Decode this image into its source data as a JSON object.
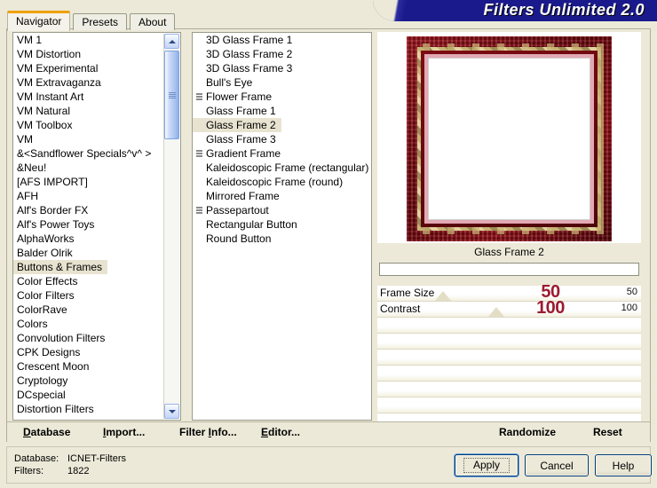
{
  "window": {
    "title": "Filters Unlimited 2.0"
  },
  "tabs": [
    {
      "label": "Navigator",
      "active": true
    },
    {
      "label": "Presets",
      "active": false
    },
    {
      "label": "About",
      "active": false
    }
  ],
  "categories": {
    "selected": "Buttons & Frames",
    "items": [
      "VM 1",
      "VM Distortion",
      "VM Experimental",
      "VM Extravaganza",
      "VM Instant Art",
      "VM Natural",
      "VM Toolbox",
      "VM",
      "&<Sandflower Specials^v^ >",
      "&Neu!",
      "[AFS IMPORT]",
      "AFH",
      "Alf's Border FX",
      "Alf's Power Toys",
      "AlphaWorks",
      "Balder Olrik",
      "Buttons & Frames",
      "Color Effects",
      "Color Filters",
      "ColorRave",
      "Colors",
      "Convolution Filters",
      "CPK Designs",
      "Crescent Moon",
      "Cryptology",
      "DCspecial",
      "Distortion Filters"
    ]
  },
  "filters": {
    "selected": "Glass Frame 2",
    "items": [
      {
        "label": "3D Glass Frame 1",
        "icon": false
      },
      {
        "label": "3D Glass Frame 2",
        "icon": false
      },
      {
        "label": "3D Glass Frame 3",
        "icon": false
      },
      {
        "label": "Bull's Eye",
        "icon": false
      },
      {
        "label": "Flower Frame",
        "icon": true
      },
      {
        "label": "Glass Frame 1",
        "icon": false
      },
      {
        "label": "Glass Frame 2",
        "icon": false
      },
      {
        "label": "Glass Frame 3",
        "icon": false
      },
      {
        "label": "Gradient Frame",
        "icon": true
      },
      {
        "label": "Kaleidoscopic Frame (rectangular)",
        "icon": false
      },
      {
        "label": "Kaleidoscopic Frame (round)",
        "icon": false
      },
      {
        "label": "Mirrored Frame",
        "icon": false
      },
      {
        "label": "Passepartout",
        "icon": true
      },
      {
        "label": "Rectangular Button",
        "icon": false
      },
      {
        "label": "Round Button",
        "icon": false
      }
    ]
  },
  "controls": {
    "title": "Glass Frame 2",
    "preset_value": "",
    "preset_placeholder": "",
    "sliders": [
      {
        "label": "Frame Size",
        "value": "50",
        "display": "50",
        "pos_pct": 22
      },
      {
        "label": "Contrast",
        "value": "100",
        "display": "100",
        "pos_pct": 42
      }
    ],
    "empty_rows": 7
  },
  "toolbar": {
    "left": [
      {
        "accel": "D",
        "rest": "atabase"
      },
      {
        "accel": "I",
        "rest": "mport..."
      }
    ],
    "filter_info": {
      "pre": "Filter ",
      "accel": "I",
      "rest": "nfo..."
    },
    "editor": {
      "accel": "E",
      "rest": "ditor..."
    },
    "randomize": "Randomize",
    "reset": "Reset"
  },
  "status": {
    "database_label": "Database:",
    "database_value": "ICNET-Filters",
    "filters_label": "Filters:",
    "filters_value": "1822"
  },
  "dialog_buttons": {
    "apply": "Apply",
    "cancel": "Cancel",
    "help": "Help"
  },
  "colors": {
    "banner": "#1a1a8c",
    "accent_orange": "#f0a000",
    "value_red": "#9b1b30",
    "panel": "#ece9d8",
    "selection": "#e8e3d0"
  }
}
